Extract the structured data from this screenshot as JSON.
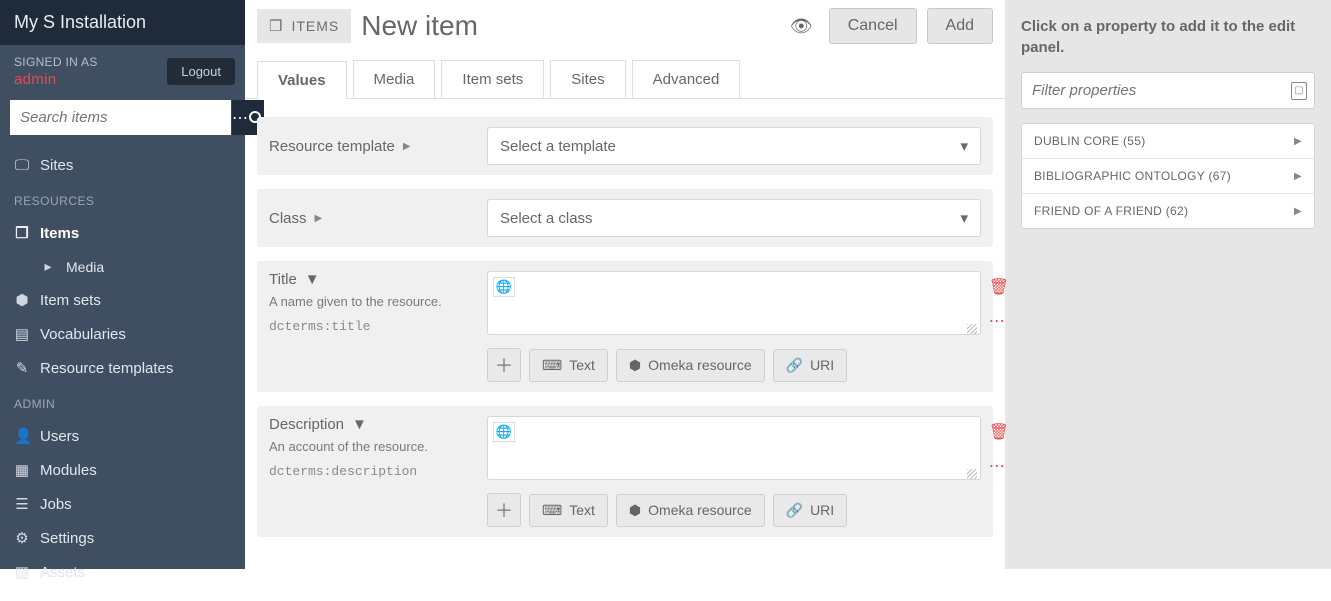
{
  "brand": "My S Installation",
  "signed_in_label": "SIGNED IN AS",
  "user_name": "admin",
  "logout_label": "Logout",
  "search_placeholder": "Search items",
  "nav": {
    "sites": "Sites",
    "sec_resources": "RESOURCES",
    "items": "Items",
    "media": "Media",
    "item_sets": "Item sets",
    "vocabularies": "Vocabularies",
    "resource_templates": "Resource templates",
    "sec_admin": "ADMIN",
    "users": "Users",
    "modules": "Modules",
    "jobs": "Jobs",
    "settings": "Settings",
    "assets": "Assets"
  },
  "header": {
    "pill": "ITEMS",
    "title": "New item",
    "cancel": "Cancel",
    "add": "Add"
  },
  "tabs": {
    "values": "Values",
    "media": "Media",
    "item_sets": "Item sets",
    "sites": "Sites",
    "advanced": "Advanced"
  },
  "form": {
    "resource_template_label": "Resource template",
    "resource_template_select": "Select a template",
    "class_label": "Class",
    "class_select": "Select a class",
    "title": {
      "label": "Title",
      "desc": "A name given to the resource.",
      "term": "dcterms:title"
    },
    "description": {
      "label": "Description",
      "desc": "An account of the resource.",
      "term": "dcterms:description"
    },
    "text_btn": "Text",
    "omeka_btn": "Omeka resource",
    "uri_btn": "URI"
  },
  "panel": {
    "hint": "Click on a property to add it to the edit panel.",
    "filter_placeholder": "Filter properties",
    "vocabs": [
      "DUBLIN CORE (55)",
      "BIBLIOGRAPHIC ONTOLOGY (67)",
      "FRIEND OF A FRIEND (62)"
    ]
  }
}
